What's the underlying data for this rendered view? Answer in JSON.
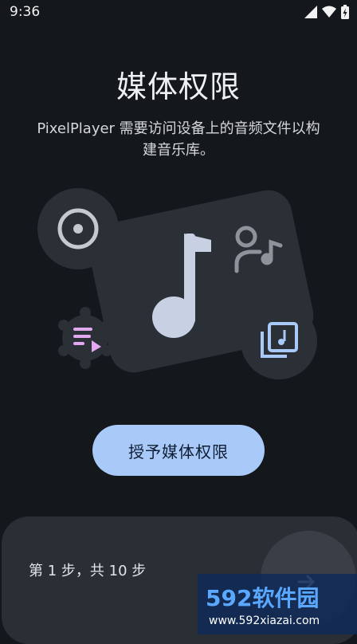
{
  "status_bar": {
    "time": "9:36"
  },
  "title": "媒体权限",
  "subtitle": "PixelPlayer 需要访问设备上的音频文件以构建音乐库。",
  "grant_button": {
    "label": "授予媒体权限"
  },
  "stepper": {
    "text": "第 1 步，共 10 步"
  },
  "watermark": {
    "brand": "592软件园",
    "url": "www.592xiazai.com"
  },
  "icons": [
    "album-icon",
    "music-note-icon",
    "artist-music-icon",
    "playlist-icon",
    "library-icon",
    "next-arrow-icon"
  ],
  "colors": {
    "background": "#14171b",
    "button": "#a9c9f8",
    "card": "#2a2e35",
    "accent_pink": "#e3a7f0"
  }
}
